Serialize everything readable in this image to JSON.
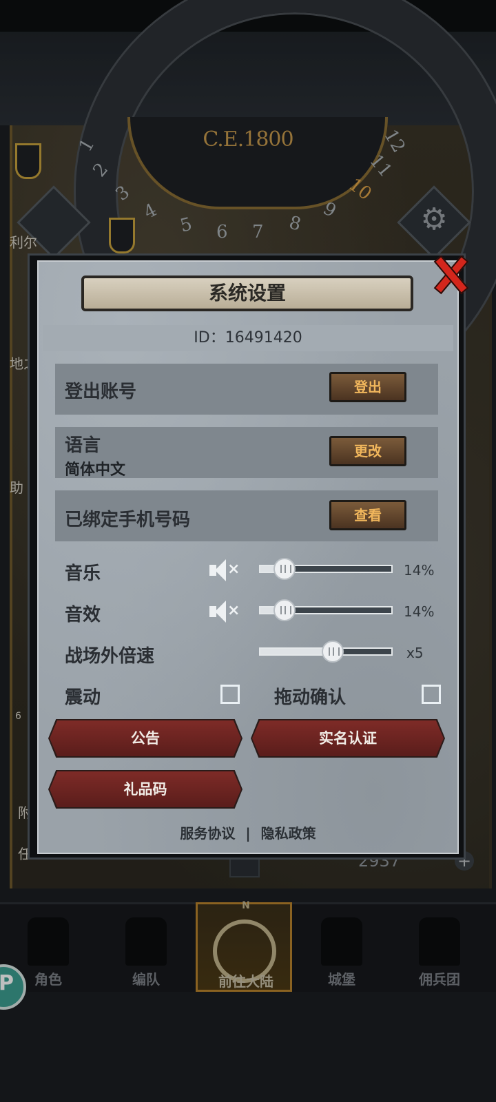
{
  "background": {
    "era": "C.E.1800",
    "dial_numbers": [
      "1",
      "2",
      "3",
      "4",
      "5",
      "6",
      "7",
      "8",
      "9",
      "10",
      "11",
      "12"
    ],
    "resource_count": "2937",
    "side_labels": [
      "利尔",
      "地之",
      "助",
      "6",
      "附",
      "任"
    ],
    "nav": {
      "items": [
        {
          "label": "角色",
          "icon": "knight-icon"
        },
        {
          "label": "编队",
          "icon": "helmet-icon"
        },
        {
          "label": "前往大陆",
          "icon": "compass-icon",
          "compass_letter": "N"
        },
        {
          "label": "城堡",
          "icon": "castle-icon"
        },
        {
          "label": "佣兵团",
          "icon": "mercenary-icon"
        }
      ],
      "active_index": 2
    },
    "badge_letter": "P"
  },
  "dialog": {
    "title": "系统设置",
    "id_text": "ID：16491420",
    "rows": {
      "logout": {
        "label": "登出账号",
        "button": "登出"
      },
      "language": {
        "label": "语言",
        "value": "简体中文",
        "button": "更改"
      },
      "phone": {
        "label": "已绑定手机号码",
        "button": "查看"
      }
    },
    "music": {
      "label": "音乐",
      "percent_text": "14%",
      "value": 0.14,
      "icon": "muted-speaker-icon"
    },
    "sfx": {
      "label": "音效",
      "percent_text": "14%",
      "value": 0.14,
      "icon": "muted-speaker-icon"
    },
    "battle_speed": {
      "label": "战场外倍速",
      "value_text": "x5",
      "value": 0.5
    },
    "vibration": {
      "label": "震动",
      "checked": false
    },
    "drag_confirm": {
      "label": "拖动确认",
      "checked": false
    },
    "buttons": {
      "notice": "公告",
      "realname": "实名认证",
      "gift_code": "礼品码"
    },
    "footer": {
      "terms": "服务协议",
      "separator": "|",
      "privacy": "隐私政策"
    },
    "colors": {
      "accent_button_text": "#f0b65c",
      "close_red": "#d4261c"
    }
  }
}
